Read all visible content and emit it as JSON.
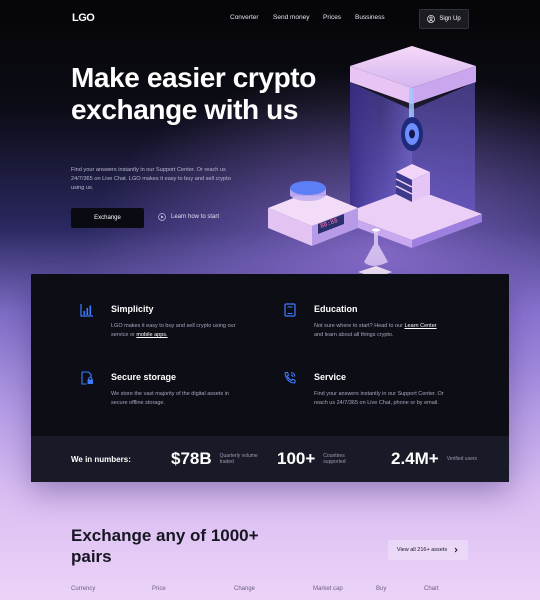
{
  "nav": {
    "logo": "LGO",
    "links": [
      "Converter",
      "Send money",
      "Prices",
      "Bussiness"
    ],
    "signup_label": "Sign Up"
  },
  "hero": {
    "title": "Make easier crypto exchange with us",
    "subtitle": "Find your answers instantly in our Support Center. Or reach us 24/7/365 on Live Chat. LGO makes it easy to buy and sell crypto using us.",
    "primary_button": "Exchange",
    "secondary_link": "Learn how to start",
    "device_display": "88:88"
  },
  "features": [
    {
      "icon": "chart-bars-icon",
      "title": "Simplicity",
      "text": "LGO makes it easy to buy and sell crypto using our service or",
      "link": "mobile apps."
    },
    {
      "icon": "book-icon",
      "title": "Education",
      "text_before": "Not sure where to start? Head to our",
      "link": "Learn Center",
      "text_after": "and learn about all things crypto."
    },
    {
      "icon": "document-lock-icon",
      "title": "Secure storage",
      "text": "We store the vast majority of the digital assets in secure offline storage."
    },
    {
      "icon": "phone-call-icon",
      "title": "Service",
      "text": "Find your answers instantly in our Support Center. Or reach us 24/7/365 on Live Chat, phone or by email."
    }
  ],
  "numbers": {
    "label": "We in numbers:",
    "stats": [
      {
        "value": "$78B",
        "caption": "Quarterly volume traded"
      },
      {
        "value": "100+",
        "caption": "Countries supported"
      },
      {
        "value": "2.4M+",
        "caption": "Verified users"
      }
    ]
  },
  "pairs": {
    "title": "Exchange any of 1000+ pairs",
    "view_all": "View all 216+ assets",
    "columns": [
      "Currency",
      "Price",
      "Change",
      "Market cap",
      "Buy",
      "Chart"
    ]
  },
  "colors": {
    "accent_blue": "#3d7dff",
    "card_bg": "#0d0d16",
    "numbers_bg": "#191a27"
  }
}
